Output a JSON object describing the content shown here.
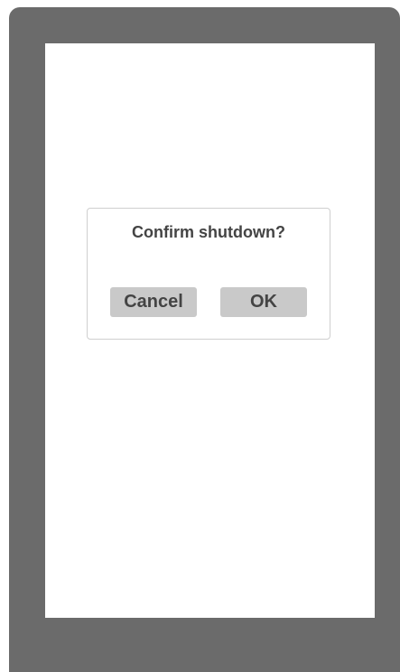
{
  "dialog": {
    "message": "Confirm shutdown?",
    "cancel_label": "Cancel",
    "ok_label": "OK"
  },
  "colors": {
    "device_frame": "#6b6b6b",
    "screen": "#ffffff",
    "button_bg": "#c9c9c9",
    "text": "#444444",
    "dialog_border": "#cfcfcf"
  }
}
